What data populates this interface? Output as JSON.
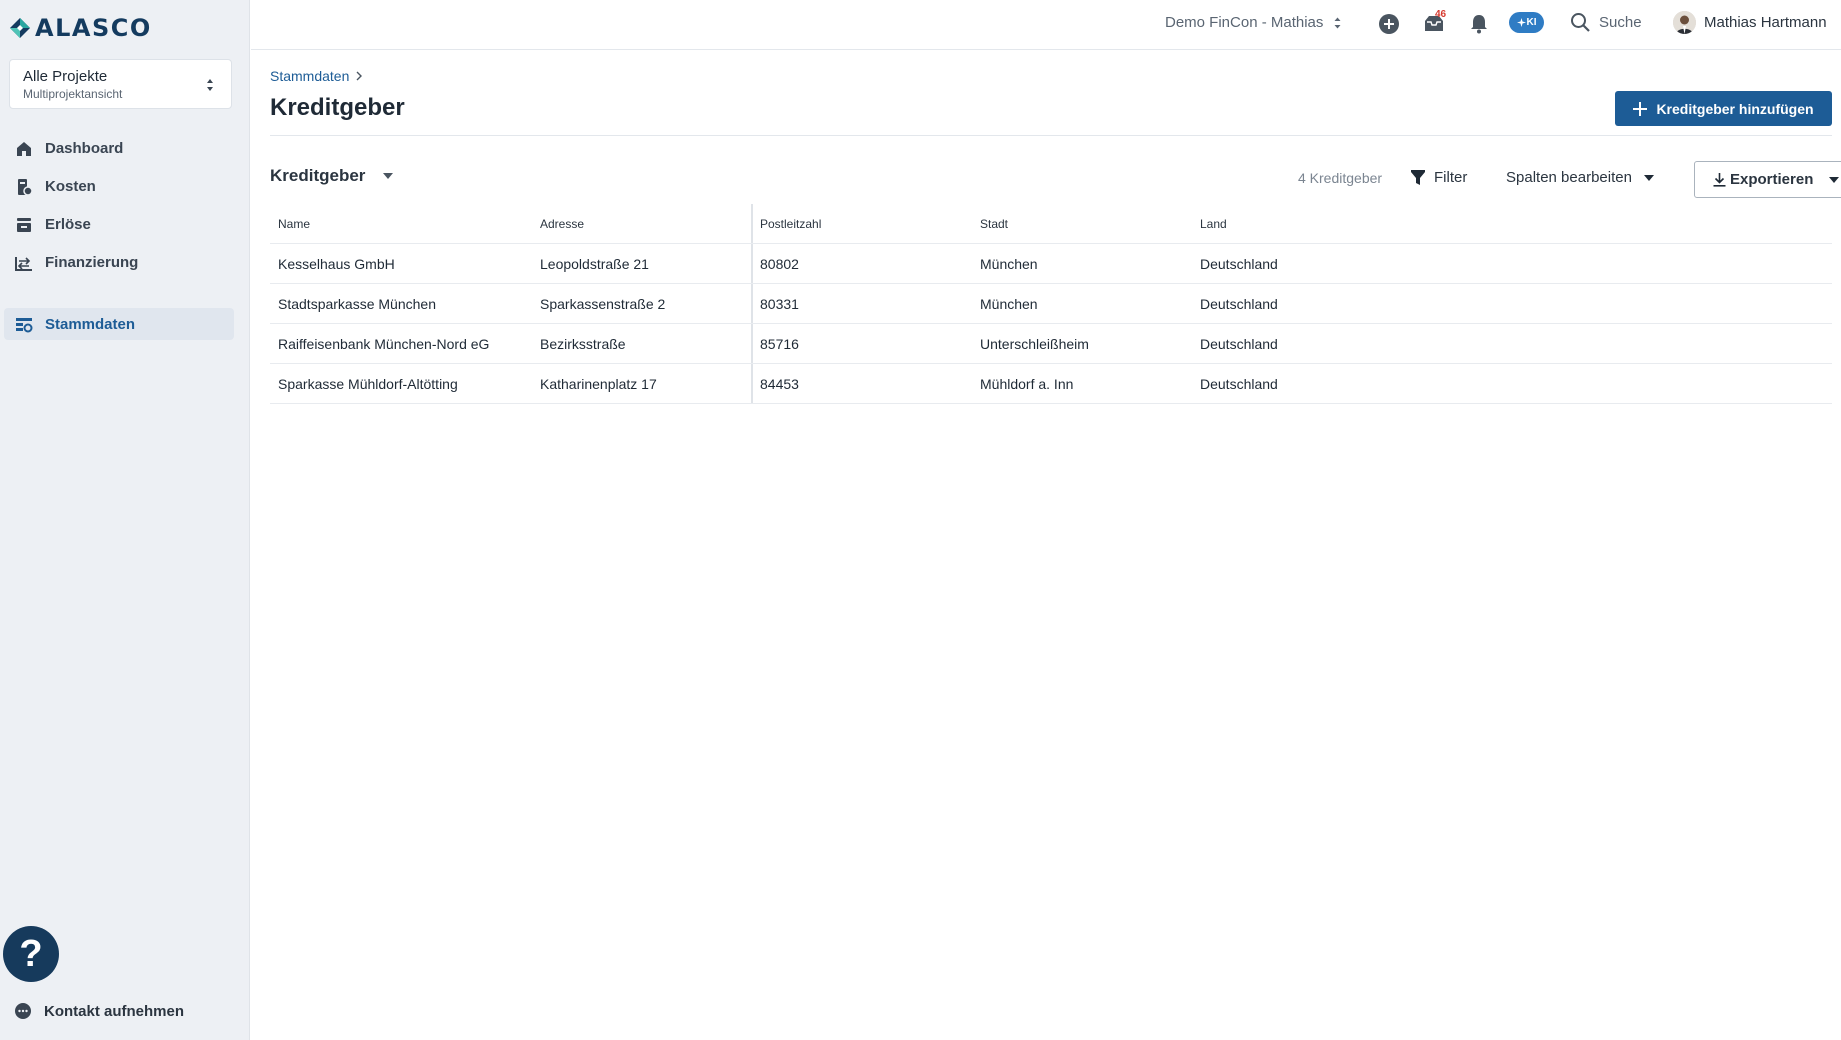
{
  "brand": {
    "name": "ALASCO",
    "accent": "#1d5c96",
    "logo_teal": "#2ba6a0"
  },
  "project_selector": {
    "title": "Alle Projekte",
    "subtitle": "Multiprojektansicht"
  },
  "sidebar": {
    "items": [
      {
        "label": "Dashboard",
        "icon": "home-icon"
      },
      {
        "label": "Kosten",
        "icon": "cost-icon"
      },
      {
        "label": "Erlöse",
        "icon": "revenue-icon"
      },
      {
        "label": "Finanzierung",
        "icon": "financing-icon"
      },
      {
        "label": "Stammdaten",
        "icon": "master-data-icon",
        "active": true
      }
    ],
    "help_label": "?",
    "contact_label": "Kontakt aufnehmen"
  },
  "topbar": {
    "tenant": "Demo FinCon - Mathias",
    "inbox_badge": "46",
    "ki_label": "KI",
    "search_label": "Suche",
    "user_name": "Mathias Hartmann"
  },
  "page": {
    "breadcrumb": "Stammdaten",
    "title": "Kreditgeber",
    "add_button": "Kreditgeber hinzufügen"
  },
  "toolbar": {
    "view_label": "Kreditgeber",
    "count_label": "4 Kreditgeber",
    "filter_label": "Filter",
    "columns_label": "Spalten bearbeiten",
    "export_label": "Exportieren"
  },
  "table": {
    "columns": [
      "Name",
      "Adresse",
      "Postleitzahl",
      "Stadt",
      "Land"
    ],
    "rows": [
      [
        "Kesselhaus GmbH",
        "Leopoldstraße 21",
        "80802",
        "München",
        "Deutschland"
      ],
      [
        "Stadtsparkasse München",
        "Sparkassenstraße 2",
        "80331",
        "München",
        "Deutschland"
      ],
      [
        "Raiffeisenbank München-Nord eG",
        "Bezirksstraße",
        "85716",
        "Unterschleißheim",
        "Deutschland"
      ],
      [
        "Sparkasse Mühldorf-Altötting",
        "Katharinenplatz 17",
        "84453",
        "Mühldorf a. Inn",
        "Deutschland"
      ]
    ]
  }
}
